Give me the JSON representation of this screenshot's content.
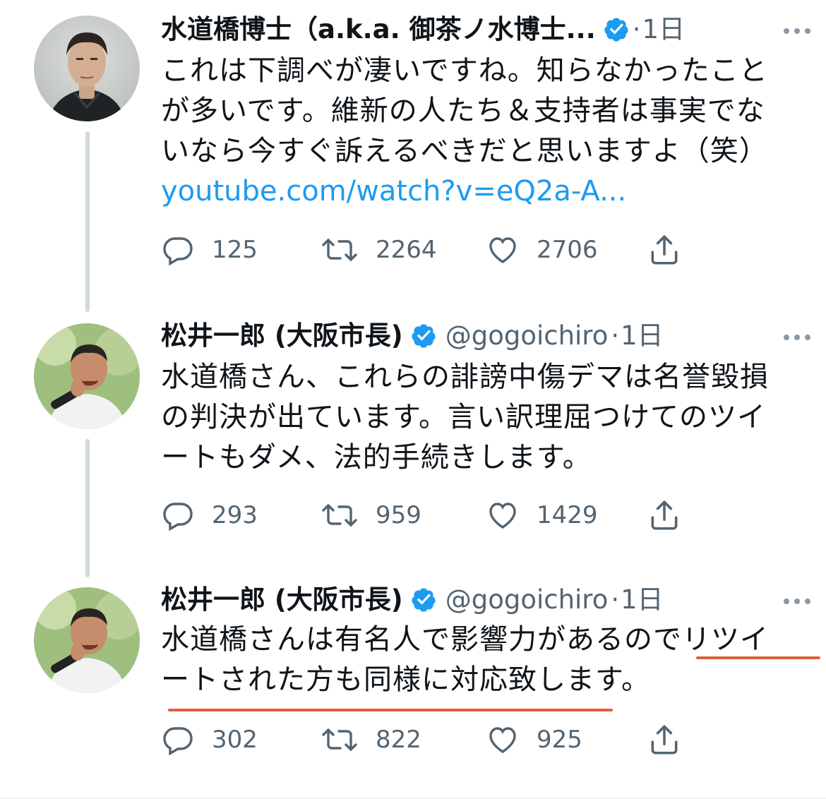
{
  "colors": {
    "accent": "#1d9bf0",
    "secondary_text": "#536471",
    "underline": "#e0603a",
    "thread_line": "#cfd9de"
  },
  "tweets": [
    {
      "name": "水道橋博士（a.k.a. 御茶ノ水博士...",
      "handle": "",
      "dot": "·",
      "time": "1日",
      "lines": [
        "これは下調べが凄いですね。知らなかったこと",
        "が多いです。維新の人たち＆支持者は事実でな",
        "いなら今すぐ訴えるべきだと思いますよ（笑）"
      ],
      "link": "youtube.com/watch?v=eQ2a-A...",
      "replies": "125",
      "retweets": "2264",
      "likes": "2706"
    },
    {
      "name": "松井一郎 (大阪市長)",
      "handle": "@gogoichiro",
      "dot": "·",
      "time": "1日",
      "lines": [
        "水道橋さん、これらの誹謗中傷デマは名誉毀損",
        "の判決が出ています。言い訳理屈つけてのツイ",
        "ートもダメ、法的手続きします。"
      ],
      "replies": "293",
      "retweets": "959",
      "likes": "1429"
    },
    {
      "name": "松井一郎 (大阪市長)",
      "handle": "@gogoichiro",
      "dot": "·",
      "time": "1日",
      "lines": [
        "水道橋さんは有名人で影響力があるのでリツイ",
        "ートされた方も同様に対応致します。"
      ],
      "replies": "302",
      "retweets": "822",
      "likes": "925"
    }
  ],
  "icons": {
    "verified": "verified-badge-icon",
    "reply": "reply-icon",
    "retweet": "retweet-icon",
    "like": "heart-icon",
    "share": "share-icon",
    "more": "more-icon"
  }
}
